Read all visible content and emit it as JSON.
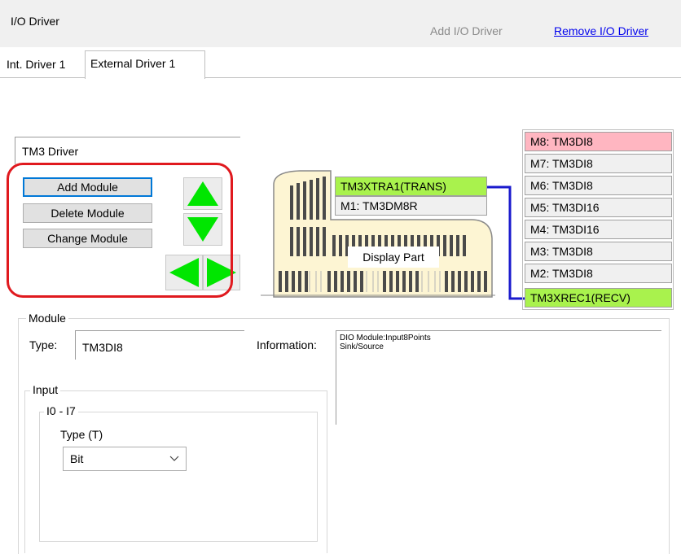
{
  "header": {
    "title": "I/O Driver",
    "add_label": "Add I/O Driver",
    "remove_label": "Remove I/O Driver"
  },
  "tabs": [
    {
      "label": "Int. Driver 1"
    },
    {
      "label": "External Driver 1"
    }
  ],
  "driver": {
    "name": "TM3 Driver"
  },
  "buttons": {
    "add_module": "Add Module",
    "delete_module": "Delete Module",
    "change_module": "Change Module"
  },
  "device": {
    "left_slots": [
      "TM3XTRA1(TRANS)",
      "M1: TM3DM8R"
    ],
    "display_label": "Display Part"
  },
  "right_slots": [
    "M8: TM3DI8",
    "M7: TM3DI8",
    "M6: TM3DI8",
    "M5: TM3DI16",
    "M4: TM3DI16",
    "M3: TM3DI8",
    "M2: TM3DI8",
    "TM3XREC1(RECV)"
  ],
  "module": {
    "group_label": "Module",
    "type_label": "Type:",
    "type_value": "TM3DI8",
    "info_label": "Information:",
    "info_line1": "DIO Module:Input8Points",
    "info_line2": "Sink/Source",
    "input_label": "Input",
    "range_label": "I0 - I7",
    "type_t_label": "Type (T)",
    "type_t_value": "Bit"
  },
  "colors": {
    "arrow": "#00e600",
    "highlight_ring": "#e0191e",
    "selected_slot": "#ffb6c1",
    "comm_slot": "#a9f24d",
    "link_line": "#1a1acd"
  },
  "icons": [
    "up-arrow-icon",
    "down-arrow-icon",
    "left-arrow-icon",
    "right-arrow-icon",
    "chevron-down-icon"
  ]
}
